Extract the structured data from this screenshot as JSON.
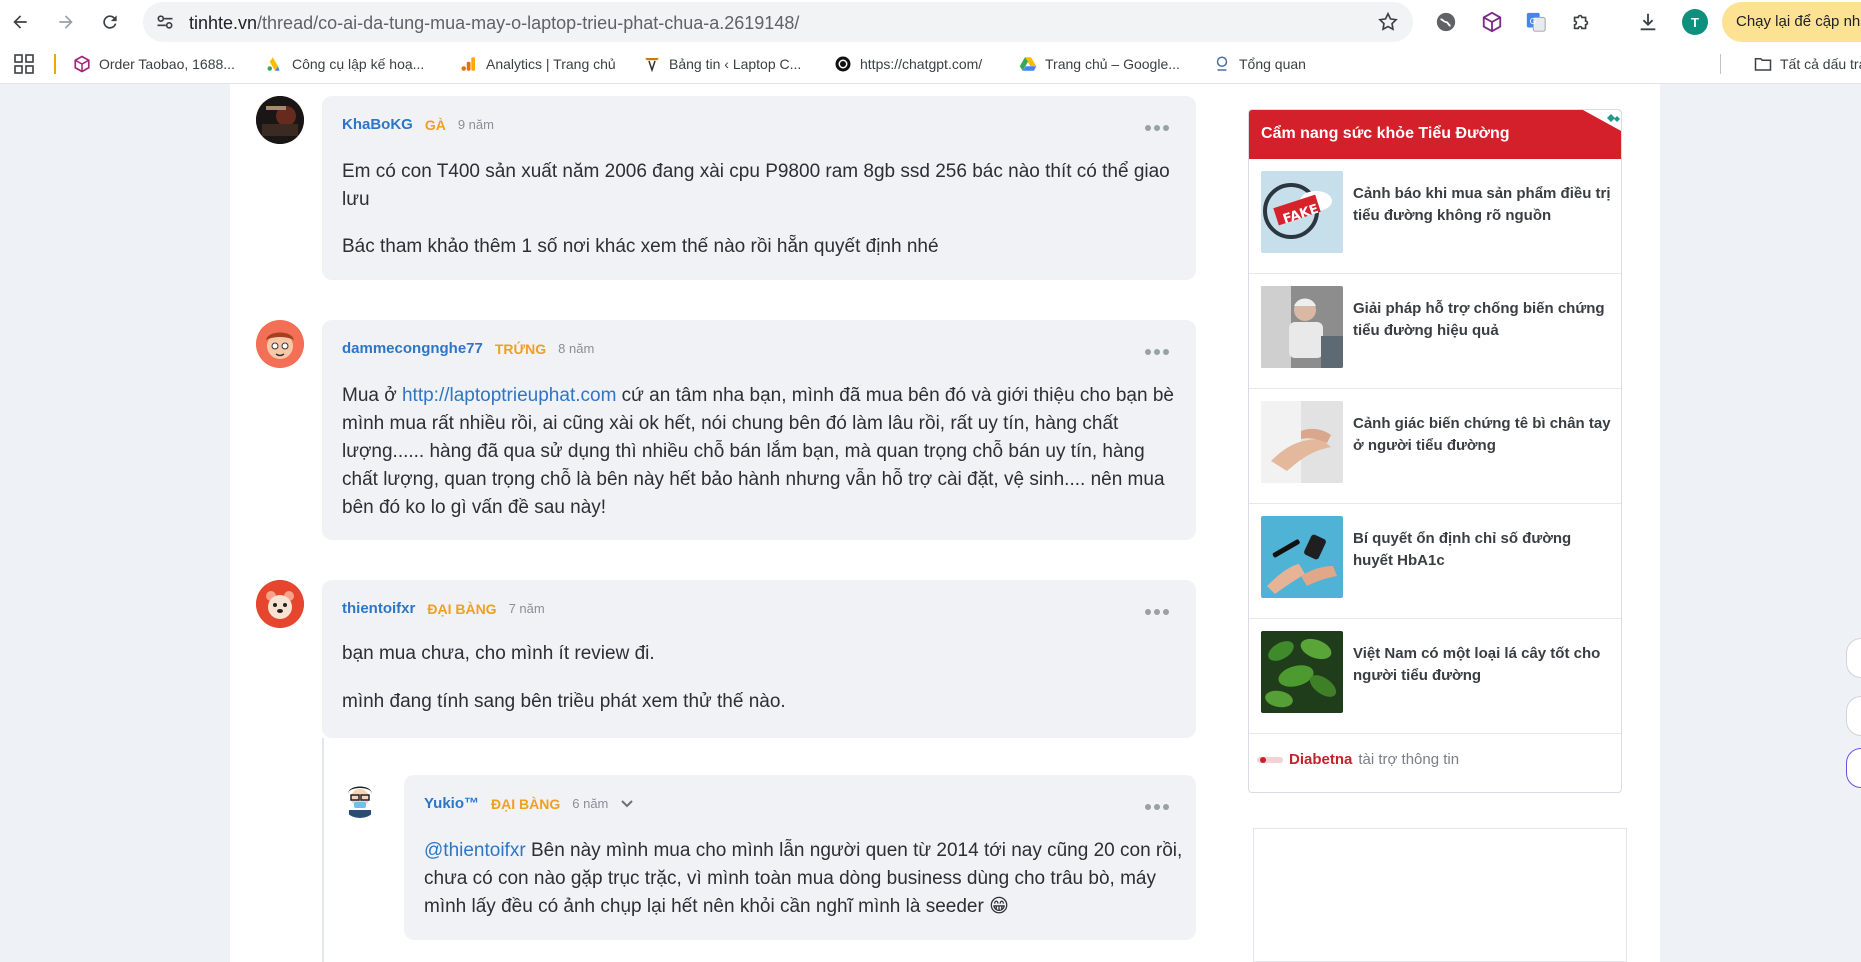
{
  "browser": {
    "url_host": "tinhte.vn",
    "url_path": "/thread/co-ai-da-tung-mua-may-o-laptop-trieu-phat-chua-a.2619148/",
    "profile_initial": "T",
    "update_button": "Chạy lại để cập nhật",
    "accent_color": "#fde293"
  },
  "bookmarks": [
    {
      "label": "Order Taobao, 1688...",
      "icon": "box-icon"
    },
    {
      "label": "Công cụ lập kế hoạ...",
      "icon": "google-ads-icon"
    },
    {
      "label": "Analytics | Trang chủ",
      "icon": "analytics-icon"
    },
    {
      "label": "Bảng tin ‹ Laptop C...",
      "icon": "wordpress-icon"
    },
    {
      "label": "https://chatgpt.com/",
      "icon": "chatgpt-icon"
    },
    {
      "label": "Trang chủ – Google...",
      "icon": "google-drive-icon"
    },
    {
      "label": "Tổng quan",
      "icon": "overview-icon"
    }
  ],
  "bookmarks_right": "Tất cả dấu trang",
  "posts": [
    {
      "user": "KhaBoKG",
      "rank": "GÀ",
      "time": "9 năm",
      "paragraphs": [
        "Em có con T400 sản xuất năm 2006 đang xài cpu P9800 ram 8gb ssd 256 bác nào thít có thể giao lưu",
        "Bác tham khảo thêm 1 số nơi khác xem thế nào rồi hẵn quyết định nhé"
      ]
    },
    {
      "user": "dammecongnghe77",
      "rank": "TRỨNG",
      "time": "8 năm",
      "prefix": "Mua ở ",
      "link": "http://laptoptrieuphat.com",
      "body": " cứ an tâm nha bạn, mình đã mua bên đó và giới thiệu cho bạn bè mình mua rất nhiều rồi, ai cũng xài ok hết, nói chung bên đó làm lâu rồi, rất uy tín, hàng chất lượng...... hàng đã qua sử dụng thì nhiều chỗ bán lắm bạn, mà quan trọng chỗ bán uy tín, hàng chất lượng, quan trọng chỗ là bên này hết bảo hành nhưng vẫn hỗ trợ cài đặt, vệ sinh.... nên mua bên đó ko lo gì vấn đề sau này!"
    },
    {
      "user": "thientoifxr",
      "rank": "ĐẠI BÀNG",
      "time": "7 năm",
      "paragraphs": [
        "bạn mua chưa, cho mình ít review đi.",
        "mình đang tính sang bên triều phát xem thử thế nào."
      ]
    },
    {
      "user": "Yukio™",
      "rank": "ĐẠI BÀNG",
      "time": "6 năm",
      "mention": "@thientoifxr",
      "body": " Bên này mình mua cho mình lẫn người quen từ 2014 tới nay cũng 20 con rồi, chưa có con nào gặp trục trặc, vì mình toàn mua dòng business dùng cho trâu bò, máy mình lấy đều có ảnh chụp lại hết nên khỏi cần nghĩ mình là seeder 😁"
    }
  ],
  "ad": {
    "title": "Cẩm nang sức khỏe Tiểu Đường",
    "header_color": "#d4202a",
    "items": [
      {
        "text": "Cảnh báo khi mua sản phẩm điều trị tiểu đường không rõ nguồn",
        "thumb_label": "FAKE"
      },
      {
        "text": "Giải pháp hỗ trợ chống biến chứng tiểu đường hiệu quả"
      },
      {
        "text": "Cảnh giác biến chứng tê bì chân tay ở người tiểu đường"
      },
      {
        "text": "Bí quyết ổn định chỉ số đường huyết HbA1c"
      },
      {
        "text": "Việt Nam có một loại lá cây tốt cho người tiểu đường"
      }
    ],
    "brand": "Diabetna",
    "sponsor_text": "tài trợ thông tin"
  }
}
